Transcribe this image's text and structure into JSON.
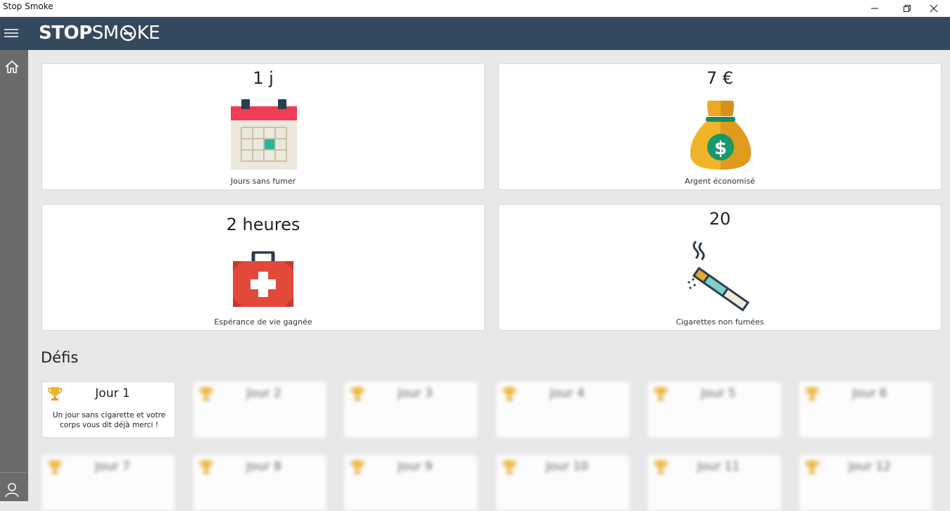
{
  "window": {
    "title": "Stop Smoke"
  },
  "app": {
    "logo_bold": "STOP",
    "logo_light": "SM",
    "logo_end": "KE"
  },
  "stats": [
    {
      "value": "1 j",
      "label": "Jours sans fumer",
      "icon": "calendar-icon"
    },
    {
      "value": "7 €",
      "label": "Argent économisé",
      "icon": "money-bag-icon"
    },
    {
      "value": "2 heures",
      "label": "Espérance de vie gagnée",
      "icon": "medical-kit-icon"
    },
    {
      "value": "20",
      "label": "Cigarettes non fumées",
      "icon": "cigarette-icon"
    }
  ],
  "challenges": {
    "title": "Défis",
    "items": [
      {
        "title": "Jour 1",
        "desc": "Un jour sans cigarette et votre corps vous dit déjà merci !",
        "locked": false
      },
      {
        "title": "Jour 2",
        "desc": "",
        "locked": true
      },
      {
        "title": "Jour 3",
        "desc": "",
        "locked": true
      },
      {
        "title": "Jour 4",
        "desc": "",
        "locked": true
      },
      {
        "title": "Jour 5",
        "desc": "",
        "locked": true
      },
      {
        "title": "Jour 6",
        "desc": "",
        "locked": true
      },
      {
        "title": "Jour 7",
        "desc": "",
        "locked": true
      },
      {
        "title": "Jour 8",
        "desc": "",
        "locked": true
      },
      {
        "title": "Jour 9",
        "desc": "",
        "locked": true
      },
      {
        "title": "Jour 10",
        "desc": "",
        "locked": true
      },
      {
        "title": "Jour 11",
        "desc": "",
        "locked": true
      },
      {
        "title": "Jour 12",
        "desc": "",
        "locked": true
      }
    ]
  },
  "colors": {
    "appbar": "#34495e",
    "sidebar": "#6b6b6b",
    "background": "#e8e8e8",
    "trophy": "#f0b429"
  }
}
